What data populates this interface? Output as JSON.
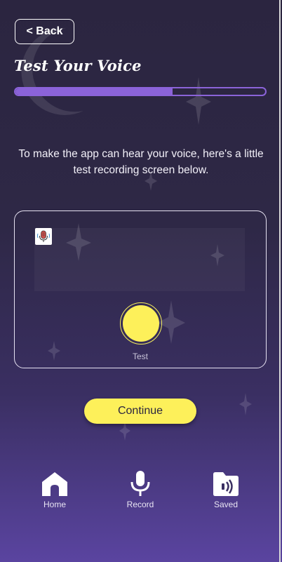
{
  "header": {
    "back_label": "< Back",
    "title": "Test Your Voice"
  },
  "progress": {
    "value": 0.63
  },
  "instructions": "To make the app can hear your voice, here's a little test recording screen below.",
  "recorder": {
    "button_label": "Test"
  },
  "continue_label": "Continue",
  "nav": {
    "items": [
      {
        "label": "Home",
        "icon": "home-icon"
      },
      {
        "label": "Record",
        "icon": "microphone-icon"
      },
      {
        "label": "Saved",
        "icon": "saved-folder-icon"
      }
    ]
  },
  "colors": {
    "accent": "#8b63d9",
    "button_yellow": "#fdf05a",
    "background_top": "#2b2540",
    "background_bottom": "#5a44a0"
  }
}
